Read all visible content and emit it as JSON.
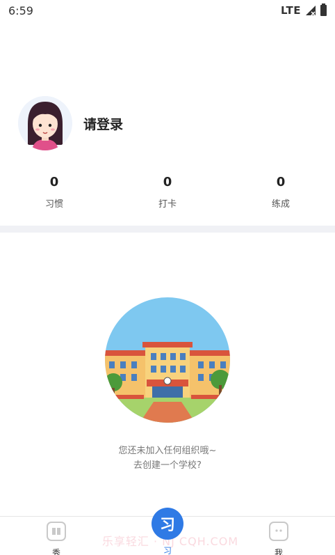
{
  "status_bar": {
    "time": "6:59",
    "network": "LTE"
  },
  "profile": {
    "login_prompt": "请登录"
  },
  "stats": [
    {
      "value": "0",
      "label": "习惯"
    },
    {
      "value": "0",
      "label": "打卡"
    },
    {
      "value": "0",
      "label": "练成"
    }
  ],
  "empty_state": {
    "line1": "您还未加入任何组织哦~",
    "line2": "去创建一个学校?"
  },
  "nav": {
    "left_label": "秀",
    "center_label": "习",
    "right_label": "我",
    "center_glyph": "习",
    "watermark": "乐享轻汇 · NJ CQH.COM"
  },
  "colors": {
    "accent": "#2f7ae5",
    "divider": "#f0f1f5"
  }
}
